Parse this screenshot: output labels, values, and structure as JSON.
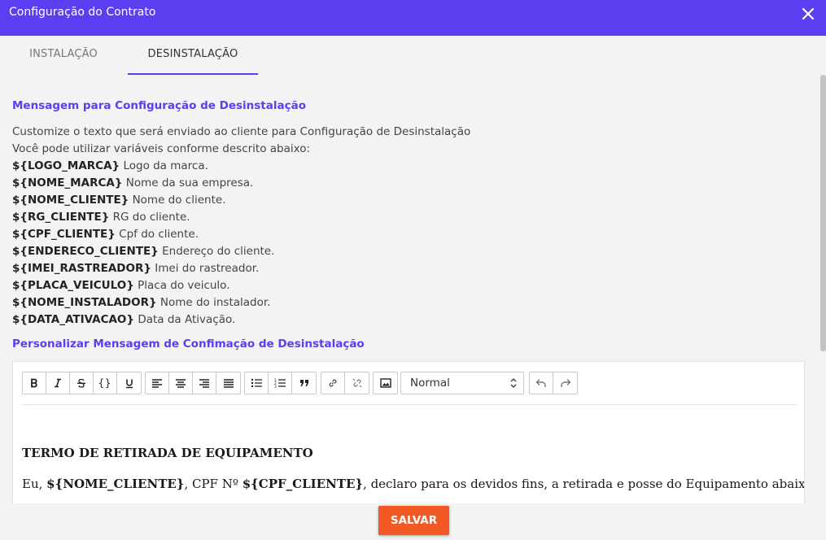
{
  "dialog": {
    "title": "Configuração do Contrato"
  },
  "tabs": [
    {
      "label": "INSTALAÇÃO",
      "active": false
    },
    {
      "label": "DESINSTALAÇÃO",
      "active": true
    }
  ],
  "section1": {
    "heading": "Mensagem para Configuração de Desinstalação",
    "intro1": "Customize o texto que será enviado ao cliente para Configuração de Desinstalação",
    "intro2": "Você pode utilizar variáveis conforme descrito abaixo:",
    "variables": [
      {
        "name": "${LOGO_MARCA}",
        "desc": "Logo da marca."
      },
      {
        "name": "${NOME_MARCA}",
        "desc": "Nome da sua empresa."
      },
      {
        "name": "${NOME_CLIENTE}",
        "desc": "Nome do cliente."
      },
      {
        "name": "${RG_CLIENTE}",
        "desc": "RG do cliente."
      },
      {
        "name": "${CPF_CLIENTE}",
        "desc": "Cpf do cliente."
      },
      {
        "name": "${ENDERECO_CLIENTE}",
        "desc": "Endereço do cliente."
      },
      {
        "name": "${IMEI_RASTREADOR}",
        "desc": "Imei do rastreador."
      },
      {
        "name": "${PLACA_VEICULO}",
        "desc": "Placa do veiculo."
      },
      {
        "name": "${NOME_INSTALADOR}",
        "desc": "Nome do instalador."
      },
      {
        "name": "${DATA_ATIVACAO}",
        "desc": "Data da Ativação."
      }
    ]
  },
  "section2": {
    "heading": "Personalizar Mensagem de Confimação de Desinstalação"
  },
  "editor": {
    "format_select": "Normal",
    "doc_title": "TERMO DE RETIRADA DE EQUIPAMENTO",
    "line1_a": "Eu, ",
    "line1_var1": "${NOME_CLIENTE}",
    "line1_b": ", CPF Nº ",
    "line1_var2": "${CPF_CLIENTE}",
    "line1_c": ", declaro para os devidos fins, a retirada e posse do Equipamento abaixo"
  },
  "footer": {
    "save_label": "SALVAR"
  },
  "colors": {
    "primary": "#5a3ef0",
    "save": "#f15a24"
  }
}
